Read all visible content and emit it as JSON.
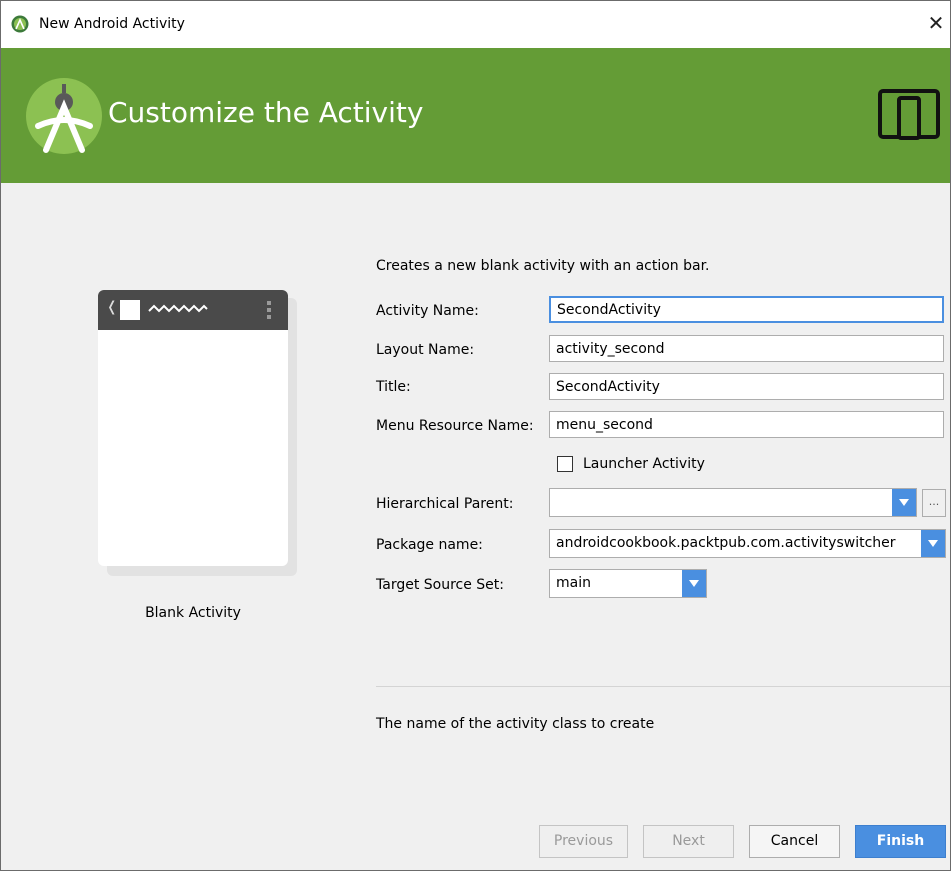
{
  "window": {
    "title": "New Android Activity",
    "close_glyph": "✕"
  },
  "banner": {
    "heading": "Customize the Activity",
    "color": "#649c36"
  },
  "preview": {
    "back_glyph": "❬",
    "label": "Blank Activity"
  },
  "form": {
    "description": "Creates a new blank activity with an action bar.",
    "activity_name": {
      "label": "Activity Name:",
      "value": "SecondActivity"
    },
    "layout_name": {
      "label": "Layout Name:",
      "value": "activity_second"
    },
    "title": {
      "label": "Title:",
      "value": "SecondActivity"
    },
    "menu_resource_name": {
      "label": "Menu Resource Name:",
      "value": "menu_second"
    },
    "launcher_activity": {
      "label": "Launcher Activity",
      "checked": false
    },
    "hierarchical_parent": {
      "label": "Hierarchical Parent:",
      "value": "",
      "browse_label": "..."
    },
    "package_name": {
      "label": "Package name:",
      "value": "androidcookbook.packtpub.com.activityswitcher"
    },
    "target_source_set": {
      "label": "Target Source Set:",
      "value": "main"
    }
  },
  "help_text": "The name of the activity class to create",
  "buttons": {
    "previous": "Previous",
    "next": "Next",
    "cancel": "Cancel",
    "finish": "Finish"
  },
  "colors": {
    "accent": "#4a8fe0"
  }
}
